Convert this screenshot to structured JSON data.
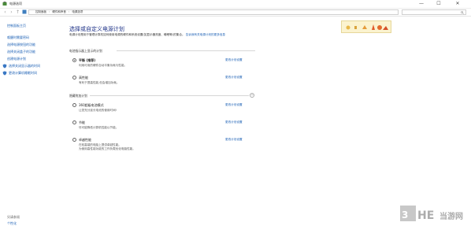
{
  "window": {
    "title": "电源选项",
    "controls": {
      "minimize": "—",
      "maximize": "☐",
      "close": "✕"
    }
  },
  "address": {
    "crumbs": [
      "控制面板",
      "硬件和声音",
      "电源选项"
    ]
  },
  "sidebar": {
    "home": "控制面板主页",
    "links": [
      {
        "label": "唤醒时需要密码"
      },
      {
        "label": "选择电源按钮的功能"
      },
      {
        "label": "选择关闭盖子的功能"
      },
      {
        "label": "创建电源计划"
      },
      {
        "label": "选择关闭显示器的时间"
      },
      {
        "label": "更改计算机睡眠时间"
      }
    ],
    "see_also": "另请参阅",
    "see_also_link": "个性化"
  },
  "main": {
    "title": "选择或自定义电源计划",
    "description": "电源计划是用于管理计算机如何使用电源的硬件和系统设置(如显示器亮度、睡眠等)的集合。",
    "description_link": "告诉我有关电源计划的更多信息",
    "group_main": "电池指示器上显示的计划",
    "group_hidden": "隐藏附加计划",
    "plans_main": [
      {
        "name": "平衡 (推荐)",
        "desc": "利用可用的硬件自动平衡功耗与性能。",
        "setting": "更改计划设置",
        "checked": true
      },
      {
        "name": "高性能",
        "desc": "有利于提高性能,但会增加功耗。",
        "setting": "更改计划设置",
        "checked": false
      }
    ],
    "plans_hidden": [
      {
        "name": "360超级电池模式",
        "desc": "让您充分延长电池的使用时间!",
        "setting": "更改计划设置",
        "checked": false
      },
      {
        "name": "节能",
        "desc": "尽可能降低计算机性能以节能。",
        "setting": "更改计划设置",
        "checked": false
      },
      {
        "name": "卓越性能",
        "desc": "在较高端的电脑上提供卓越性能。",
        "desc2": "为使用高性能功能的工作负载优化电脑性能。",
        "setting": "更改计划设置",
        "checked": false
      }
    ]
  },
  "colors": {
    "link": "#1a5fb4",
    "title": "#1e3287"
  }
}
